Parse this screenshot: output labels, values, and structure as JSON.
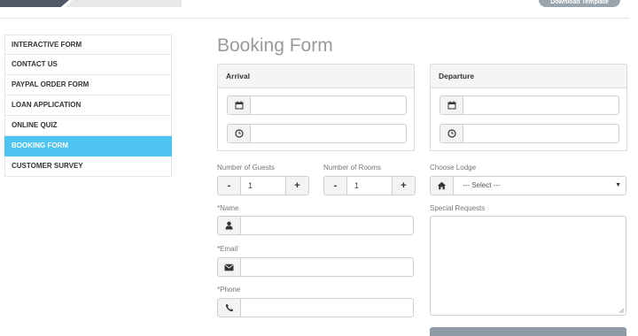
{
  "top": {
    "download_label": "Download Template"
  },
  "sidebar": {
    "items": [
      {
        "label": "INTERACTIVE FORM",
        "active": false
      },
      {
        "label": "CONTACT US",
        "active": false
      },
      {
        "label": "PAYPAL ORDER FORM",
        "active": false
      },
      {
        "label": "LOAN APPLICATION",
        "active": false
      },
      {
        "label": "ONLINE QUIZ",
        "active": false
      },
      {
        "label": "BOOKING FORM",
        "active": true
      },
      {
        "label": "CUSTOMER SURVEY",
        "active": false
      }
    ]
  },
  "form": {
    "title": "Booking Form",
    "arrival": {
      "heading": "Arrival",
      "date_value": "",
      "time_value": "",
      "date_icon": "calendar-icon",
      "time_icon": "clock-icon"
    },
    "departure": {
      "heading": "Departure",
      "date_value": "",
      "time_value": "",
      "date_icon": "calendar-icon",
      "time_icon": "clock-icon"
    },
    "guests": {
      "label": "Number of Guests",
      "minus": "-",
      "value": "1",
      "plus": "+"
    },
    "rooms": {
      "label": "Number of Rooms",
      "minus": "-",
      "value": "1",
      "plus": "+"
    },
    "lodge": {
      "label": "Choose Lodge",
      "selected": "--- Select ---",
      "icon": "home-icon"
    },
    "name": {
      "required_mark": "*",
      "label": "Name",
      "value": "",
      "icon": "user-icon"
    },
    "email": {
      "required_mark": "*",
      "label": "Email",
      "value": "",
      "icon": "envelope-icon"
    },
    "phone": {
      "required_mark": "*",
      "label": "Phone",
      "value": "",
      "icon": "phone-icon"
    },
    "requests": {
      "label": "Special Requests",
      "value": ""
    }
  },
  "colors": {
    "accent": "#4ec4f2",
    "title_gray": "#9a9a9a",
    "border": "#cfcfcf"
  }
}
